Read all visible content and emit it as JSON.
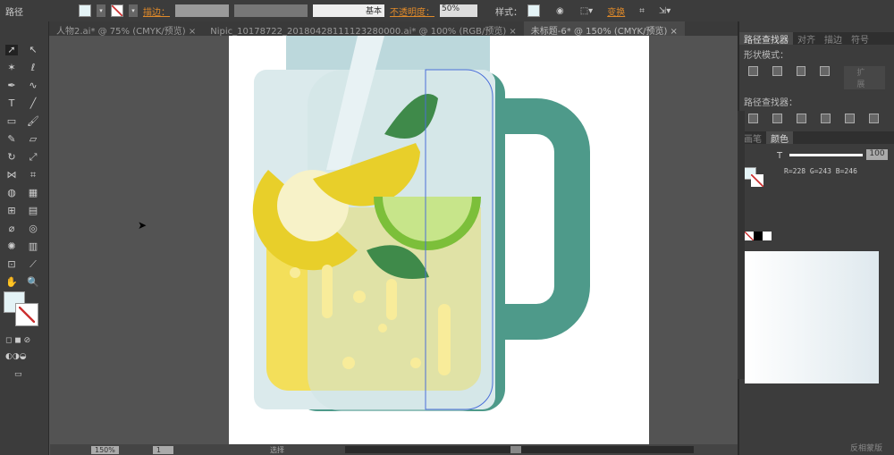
{
  "toolbar": {
    "object_type": "路径",
    "stroke_label": "描边：",
    "stroke_style": "基本",
    "opacity_label": "不透明度：",
    "opacity_value": "50%",
    "style_label": "样式：",
    "transform_label": "变换"
  },
  "tabs": [
    {
      "label": "人物2.ai* @ 75% (CMYK/预览)",
      "close": "×"
    },
    {
      "label": "Nipic_10178722_20180428111123280000.ai* @ 100% (RGB/预览)",
      "close": "×"
    },
    {
      "label": "未标题-6* @ 150% (CMYK/预览)",
      "close": "×",
      "active": true
    }
  ],
  "right_panel": {
    "tabs": [
      "路径查找器",
      "对齐",
      "描边",
      "符号"
    ],
    "shape_modes_label": "形状模式：",
    "expand_label": "扩展",
    "pathfinder_label": "路径查找器：",
    "color_tabs": [
      "画笔",
      "颜色"
    ],
    "tint_label": "T",
    "tint_value": "100",
    "rgb_readout": "R=228 G=243 B=246",
    "fill_color": "#e4f3f6",
    "bottom_labels": [
      "反相蒙版"
    ]
  },
  "status": {
    "zoom": "150%",
    "page": "1",
    "tool": "选择"
  },
  "colors": {
    "handle": "#4e9a8a",
    "jar": "#cfe3e6",
    "lemonade": "#f3df5a",
    "lime": "#7cbf3a",
    "leaf": "#3f8a4a"
  }
}
